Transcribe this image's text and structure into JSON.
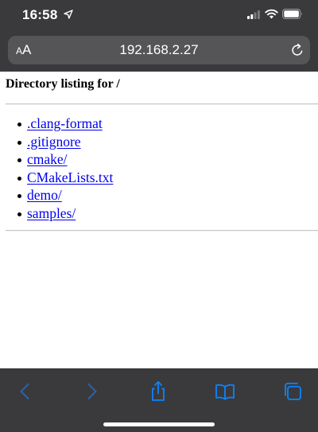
{
  "status_bar": {
    "time": "16:58",
    "location_icon": "location-arrow-icon",
    "signal_icon": "cellular-signal-icon",
    "wifi_icon": "wifi-icon",
    "battery_icon": "battery-icon"
  },
  "address_bar": {
    "reader_label_small": "A",
    "reader_label_large": "A",
    "url": "192.168.2.27",
    "reload_icon": "reload-icon"
  },
  "page": {
    "title": "Directory listing for /",
    "entries": [
      {
        "label": ".clang-format"
      },
      {
        "label": ".gitignore"
      },
      {
        "label": "cmake/"
      },
      {
        "label": "CMakeLists.txt"
      },
      {
        "label": "demo/"
      },
      {
        "label": "samples/"
      }
    ]
  },
  "toolbar": {
    "back_icon": "back-chevron-icon",
    "forward_icon": "forward-chevron-icon",
    "share_icon": "share-icon",
    "bookmarks_icon": "bookmarks-icon",
    "tabs_icon": "tabs-icon"
  },
  "colors": {
    "chrome": "#3a3a3c",
    "url_field": "#555558",
    "toolbar_icon_active": "#0a84ff",
    "toolbar_icon_disabled": "#2f5fa0",
    "link": "#0000ee"
  }
}
